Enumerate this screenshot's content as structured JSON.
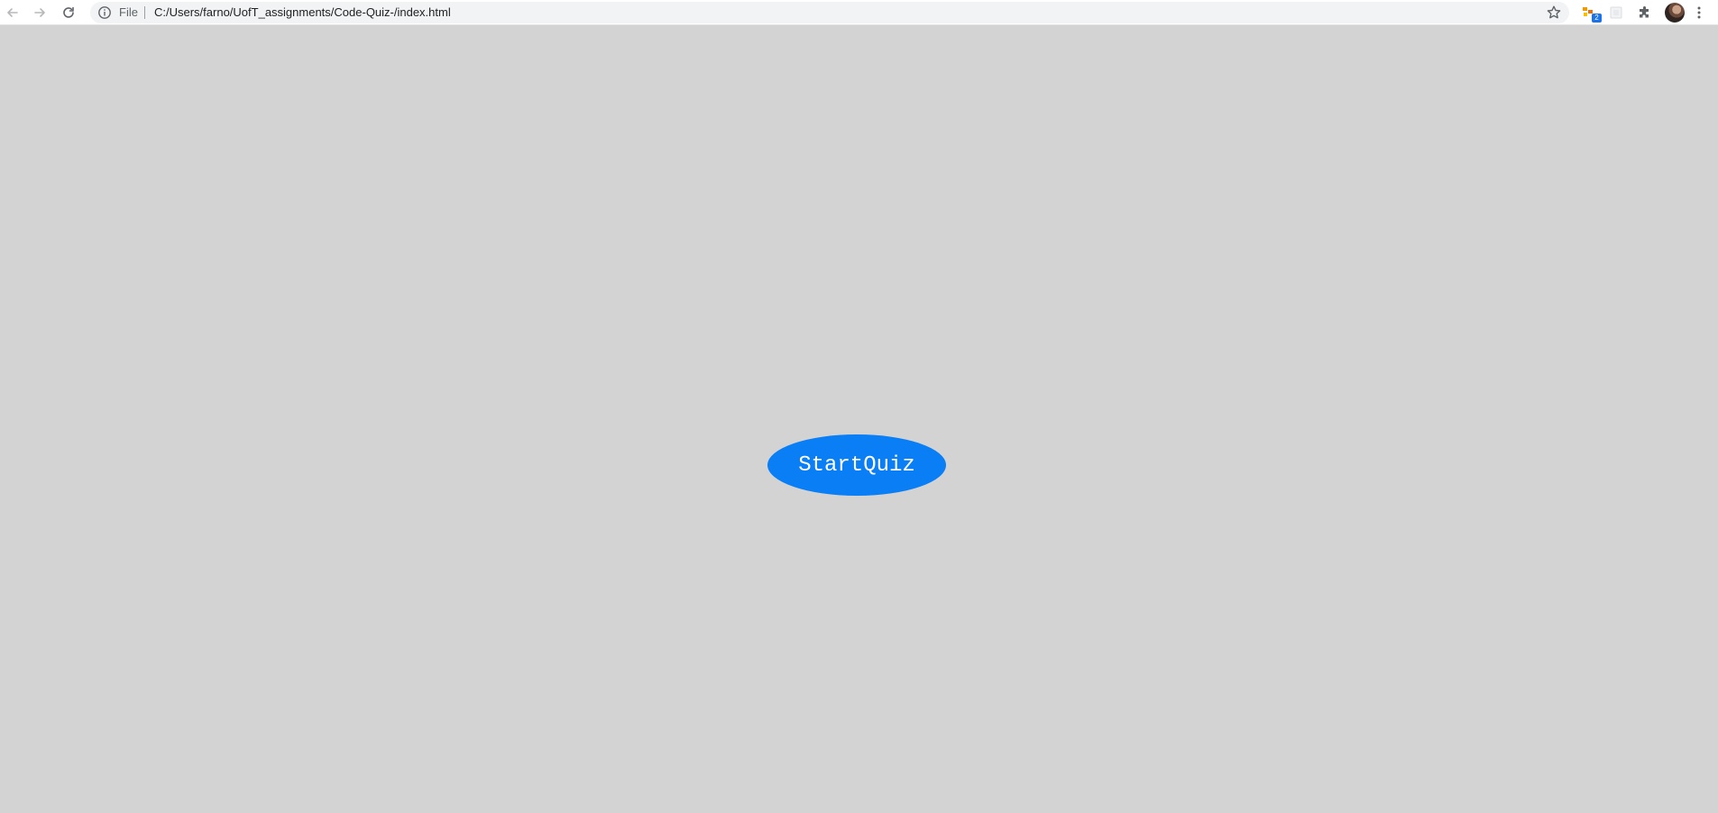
{
  "browser": {
    "omnibox": {
      "scheme_label": "File",
      "url": "C:/Users/farno/UofT_assignments/Code-Quiz-/index.html"
    },
    "extensions": {
      "badge_count": "2"
    },
    "icons": {
      "back": "arrow-left-icon",
      "forward": "arrow-right-icon",
      "reload": "reload-icon",
      "info": "info-icon",
      "bookmark": "star-icon",
      "puzzle": "puzzle-icon",
      "menu": "kebab-menu-icon"
    }
  },
  "page": {
    "background_color": "#d3d3d3",
    "start_button": {
      "label": "StartQuiz",
      "color": "#0a7ef5",
      "text_color": "#ffffff"
    }
  }
}
